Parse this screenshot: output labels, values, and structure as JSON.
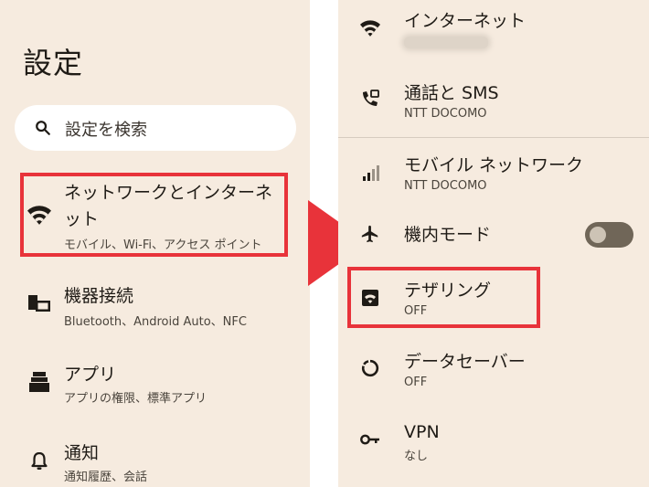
{
  "left": {
    "title": "設定",
    "search_label": "設定を検索",
    "items": [
      {
        "title_line1": "ネットワークとインターネ",
        "title_line2": "ット",
        "subtitle": "モバイル、Wi-Fi、アクセス ポイント",
        "icon": "wifi-icon"
      },
      {
        "title": "機器接続",
        "subtitle": "Bluetooth、Android Auto、NFC",
        "icon": "devices-icon"
      },
      {
        "title": "アプリ",
        "subtitle": "アプリの権限、標準アプリ",
        "icon": "apps-icon"
      },
      {
        "title": "通知",
        "subtitle": "通知履歴、会話",
        "icon": "bell-icon"
      }
    ]
  },
  "right": {
    "items": [
      {
        "title": "インターネット",
        "subtitle": "",
        "icon": "wifi-icon"
      },
      {
        "title": "通話と SMS",
        "subtitle": "NTT DOCOMO",
        "icon": "call-sms-icon"
      },
      {
        "title": "モバイル ネットワーク",
        "subtitle": "NTT DOCOMO",
        "icon": "signal-icon"
      },
      {
        "title": "機内モード",
        "subtitle": "",
        "icon": "airplane-icon",
        "toggle_on": false
      },
      {
        "title": "テザリング",
        "subtitle": "OFF",
        "icon": "hotspot-icon"
      },
      {
        "title": "データセーバー",
        "subtitle": "OFF",
        "icon": "data-saver-icon"
      },
      {
        "title": "VPN",
        "subtitle": "なし",
        "icon": "vpn-key-icon"
      }
    ]
  },
  "colors": {
    "background": "#f6ebdf",
    "highlight": "#e8333a",
    "icon": "#1f1b16"
  }
}
